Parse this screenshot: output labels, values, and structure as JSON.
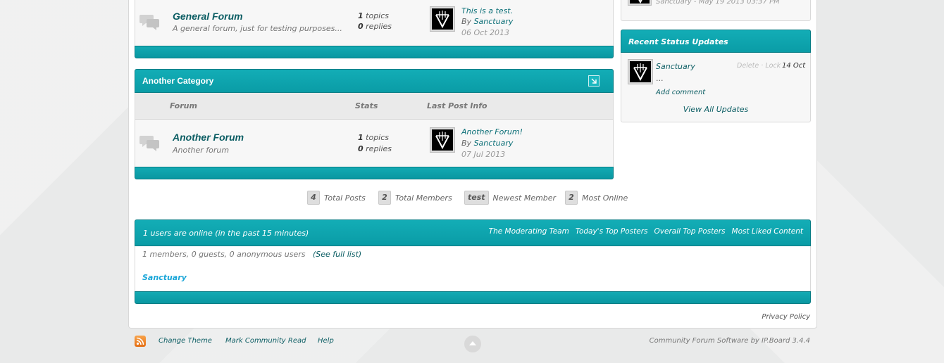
{
  "forums": [
    {
      "title": "General Forum",
      "description": "A general forum, just for testing purposes...",
      "topics_count": "1",
      "topics_label": "topics",
      "replies_count": "0",
      "replies_label": "replies",
      "last_post_title": "This is a test.",
      "last_post_by": "By",
      "last_post_author": "Sanctuary",
      "last_post_date": "06 Oct 2013"
    },
    {
      "title": "Another Forum",
      "description": "Another forum",
      "topics_count": "1",
      "topics_label": "topics",
      "replies_count": "0",
      "replies_label": "replies",
      "last_post_title": "Another Forum!",
      "last_post_by": "By",
      "last_post_author": "Sanctuary",
      "last_post_date": "07 Jul 2013"
    }
  ],
  "category": {
    "title": "Another Category",
    "columns": [
      "Forum",
      "Stats",
      "Last Post Info"
    ]
  },
  "board_stats": [
    {
      "value": "4",
      "label": "Total Posts"
    },
    {
      "value": "2",
      "label": "Total Members"
    },
    {
      "value": "test",
      "label": "Newest Member"
    },
    {
      "value": "2",
      "label": "Most Online"
    }
  ],
  "online": {
    "title": "1 users are online (in the past 15 minutes)",
    "links": [
      "The Moderating Team",
      "Today's Top Posters",
      "Overall Top Posters",
      "Most Liked Content"
    ],
    "summary": "1 members, 0 guests, 0 anonymous users",
    "full_list": "(See full list)",
    "users": [
      "Sanctuary"
    ]
  },
  "sidebar": {
    "top_partial": "Sanctuary - May 19 2013 03:37 PM",
    "status_title": "Recent Status Updates",
    "status": {
      "author": "Sanctuary",
      "delete": "Delete",
      "separator": "·",
      "lock": "Lock",
      "date": "14 Oct",
      "text": "...",
      "add_comment": "Add comment"
    },
    "view_all": "View All Updates"
  },
  "footer": {
    "change_theme": "Change Theme",
    "mark_read": "Mark Community Read",
    "help": "Help",
    "privacy": "Privacy Policy",
    "credit": "Community Forum Software by IP.Board 3.4.4"
  },
  "colors": {
    "accent": "#0ea3ad",
    "link": "#0b5d63",
    "online_user": "#1aa6d8"
  }
}
